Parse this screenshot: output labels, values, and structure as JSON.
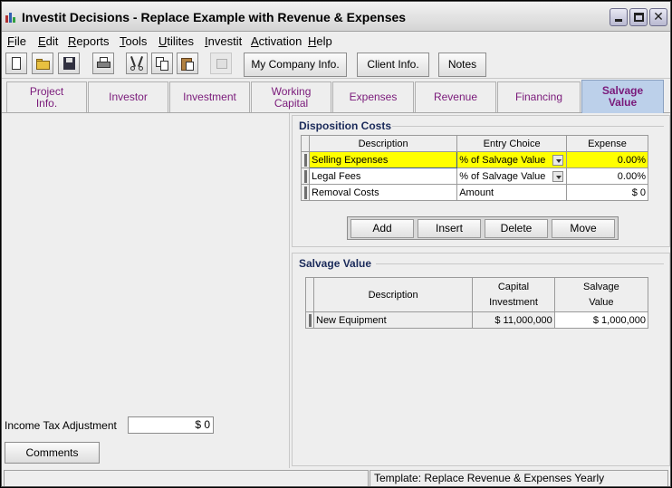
{
  "window": {
    "title": "Investit Decisions  - Replace Example with Revenue & Expenses"
  },
  "menu": [
    "File",
    "Edit",
    "Reports",
    "Tools",
    "Utilites",
    "Investit",
    "Activation",
    "Help"
  ],
  "toolbar": {
    "icons": [
      "new-file-icon",
      "open-folder-icon",
      "save-icon",
      "print-icon",
      "cut-icon",
      "copy-icon",
      "paste-icon",
      "calculator-icon"
    ],
    "my_company_label": "My Company Info.",
    "client_info_label": "Client Info.",
    "notes_label": "Notes"
  },
  "tabs": [
    {
      "label": "Project\nInfo.",
      "active": false
    },
    {
      "label": "Investor",
      "active": false
    },
    {
      "label": "Investment",
      "active": false
    },
    {
      "label": "Working\nCapital",
      "active": false
    },
    {
      "label": "Expenses",
      "active": false
    },
    {
      "label": "Revenue",
      "active": false
    },
    {
      "label": "Financing",
      "active": false
    },
    {
      "label": "Salvage\nValue",
      "active": true
    }
  ],
  "disposition": {
    "title": "Disposition Costs",
    "headers": [
      "Description",
      "Entry Choice",
      "Expense"
    ],
    "rows": [
      {
        "description": "Selling Expenses",
        "choice": "% of Salvage Value",
        "expense": "0.00%",
        "selected": true
      },
      {
        "description": "Legal Fees",
        "choice": "% of Salvage Value",
        "expense": "0.00%",
        "selected": false
      },
      {
        "description": "Removal Costs",
        "choice": "Amount",
        "expense": "$ 0",
        "selected": false
      }
    ],
    "buttons": {
      "add": "Add",
      "insert": "Insert",
      "delete": "Delete",
      "move": "Move"
    }
  },
  "salvage": {
    "title": "Salvage Value",
    "headers": {
      "description": "Description",
      "capital": "Capital\nInvestment",
      "value": "Salvage\nValue"
    },
    "rows": [
      {
        "description": "New Equipment",
        "capital": "$ 11,000,000",
        "value": "$ 1,000,000"
      }
    ]
  },
  "income_tax": {
    "label": "Income Tax Adjustment",
    "value": "$ 0"
  },
  "comments_label": "Comments",
  "status": {
    "left": "",
    "template": "Template: Replace Revenue & Expenses Yearly"
  },
  "colors": {
    "active_tab": "#bcd0ea",
    "selected_row": "#ffff00",
    "tab_text": "#7a1a7a",
    "section_title": "#1a2a5a"
  }
}
